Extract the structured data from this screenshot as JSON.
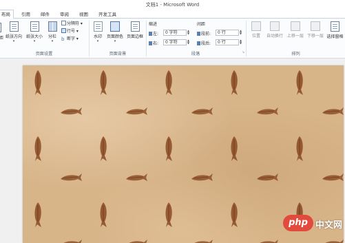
{
  "window": {
    "title": "文档1 - Microsoft Word"
  },
  "tabs": [
    {
      "label": "布局"
    },
    {
      "label": "引用"
    },
    {
      "label": "邮件"
    },
    {
      "label": "审阅"
    },
    {
      "label": "视图"
    },
    {
      "label": "开发工具"
    }
  ],
  "page_setup": {
    "label": "页面设置",
    "direction": "纸张方向",
    "size": "纸张大小",
    "columns": "分栏",
    "breaks": "分隔符",
    "line_numbers": "行号",
    "hyphenation": "断字"
  },
  "page_background": {
    "label": "页面背景",
    "watermark": "水印",
    "page_color": "页面颜色",
    "page_borders": "页面边框"
  },
  "paragraph": {
    "label": "段落",
    "indent_heading": "缩进",
    "spacing_heading": "间距",
    "indent_left_label": "左:",
    "indent_left_value": "0 字符",
    "indent_right_label": "右:",
    "indent_right_value": "0 字符",
    "spacing_before_label": "段前:",
    "spacing_before_value": "0 行",
    "spacing_after_label": "段后:",
    "spacing_after_value": "0 行"
  },
  "arrange": {
    "label": "排列",
    "position": "位置",
    "wrap_text": "自动换行",
    "bring_forward": "上移一层",
    "send_backward": "下移一层",
    "selection_pane": "选择窗格"
  },
  "watermark": {
    "logo": "php",
    "text": "中文网"
  },
  "colors": {
    "page_bg": "#d8b489",
    "fossil": "#8a4a22",
    "accent": "#2b579a"
  }
}
